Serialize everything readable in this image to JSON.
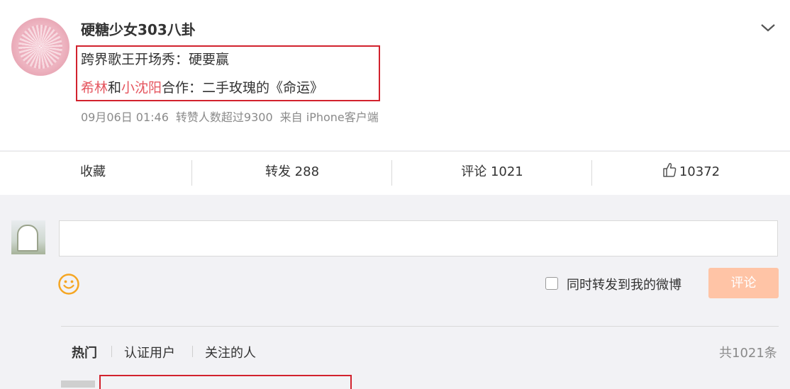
{
  "post": {
    "username": "硬糖少女303八卦",
    "line1": "跨界歌王开场秀：硬要赢",
    "line2": {
      "name1": "希林",
      "and": "和",
      "name2": "小沈阳",
      "rest": "合作：二手玫瑰的《命运》"
    },
    "meta": {
      "time": "09月06日 01:46",
      "repost_note": "转赞人数超过9300",
      "source": "来自 iPhone客户端"
    }
  },
  "actions": {
    "favorite": "收藏",
    "repost": "转发 288",
    "comment": "评论 1021",
    "like_count": "10372"
  },
  "composer": {
    "also_repost_label": "同时转发到我的微博",
    "submit_label": "评论"
  },
  "comments": {
    "tabs": [
      "热门",
      "认证用户",
      "关注的人"
    ],
    "total": "共1021条"
  },
  "colors": {
    "highlight_border": "#d2222d",
    "name_red": "#e5565f",
    "submit_bg": "#ffc4a6",
    "emoji_orange": "#f5a623"
  }
}
